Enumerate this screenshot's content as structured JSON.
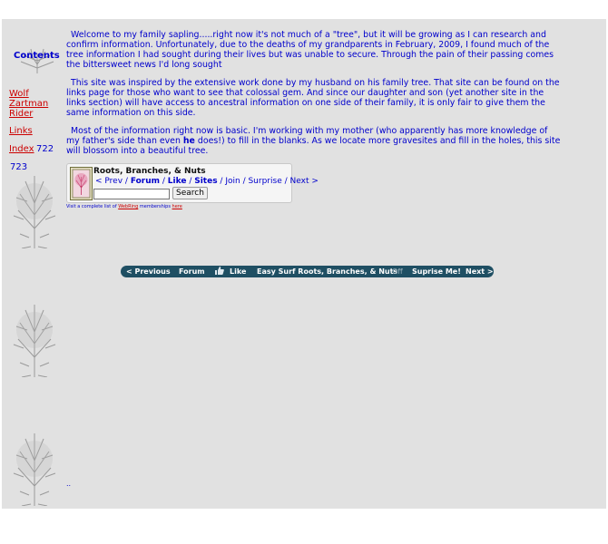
{
  "sidebar": {
    "title": "Contents",
    "links": [
      {
        "label": "Wolf"
      },
      {
        "label": "Zartman"
      },
      {
        "label": "Rider"
      },
      {
        "label": "Links"
      },
      {
        "label": "Index"
      }
    ],
    "counter_1": "722",
    "counter_2": "723"
  },
  "main": {
    "paragraph_1": "Welcome to my family sapling.....right now it's not much of a \"tree\", but it will be growing as I can research and confirm information. Unfortunately, due to the deaths of my grandparents in February, 2009, I found much of the tree information I had sought during their lives but was unable to secure. Through the pain of their passing comes the bittersweet news I'd long sought",
    "paragraph_2": "This site was inspired by the extensive work done by my husband on his family tree. That site can be found on the links page for those who want to see that colossal gem. And since our daughter and son (yet another site in the links section) will have access to ancestral information on one side of their family, it is only fair to give them the same information on this side.",
    "paragraph_3_before": "Most of the information right now is basic. I'm working with my mother (who apparently has more knowledge of my father's side than even ",
    "paragraph_3_bold": "he",
    "paragraph_3_after": " does!) to fill in the blanks. As we locate more gravesites and fill in the holes, this site will blossom into a beautiful tree."
  },
  "webring": {
    "title": "Roots, Branches, & Nuts",
    "nav": {
      "prev": "< Prev",
      "forum": "Forum",
      "like": "Like",
      "sites": "Sites",
      "join": "Join",
      "surprise": "Surprise",
      "next": "Next >",
      "sep": " / "
    },
    "search_button": "Search",
    "note_before": "Visit a complete list of ",
    "note_link": "WebRing",
    "note_middle": " memberships ",
    "note_link2": "here"
  },
  "bar": {
    "prev": "< Previous",
    "forum": "Forum",
    "like": "Like",
    "easy_surf": "Easy Surf Roots, Branches, & Nuts",
    "off": "Off",
    "surprise": "Suprise Me!",
    "next": "Next >"
  },
  "footer": {
    "dots": ".."
  },
  "colors": {
    "background": "#e1e1e1",
    "text": "#0000cc",
    "link": "#cc0000",
    "bar": "#1f4f63"
  }
}
